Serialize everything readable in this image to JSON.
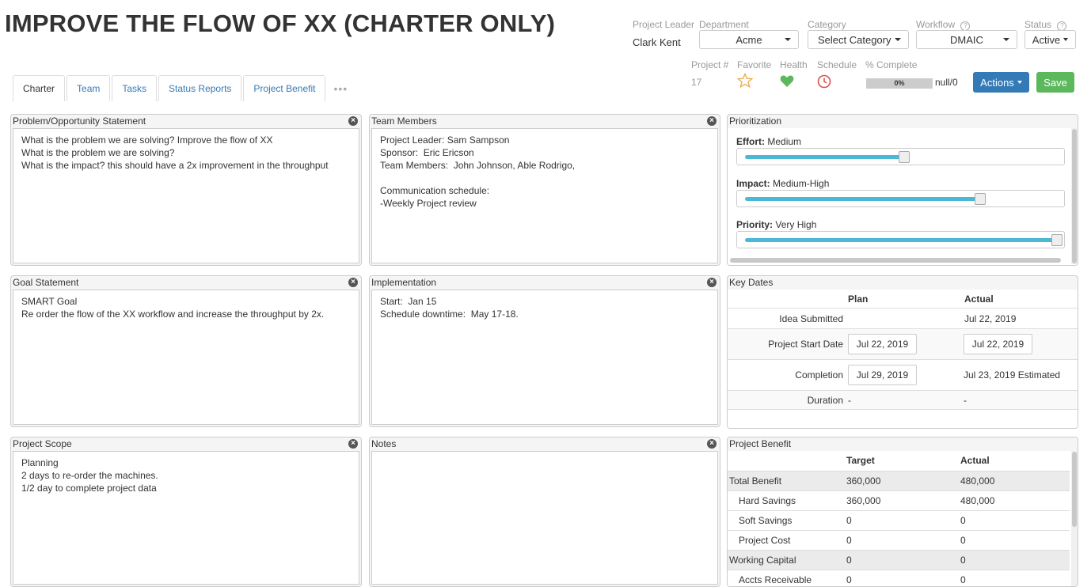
{
  "title": "IMPROVE THE FLOW OF XX (CHARTER ONLY)",
  "header": {
    "project_leader_label": "Project Leader",
    "project_leader": "Clark Kent",
    "department_label": "Department",
    "department": "Acme",
    "category_label": "Category",
    "category": "Select Category",
    "workflow_label": "Workflow",
    "workflow": "DMAIC",
    "status_label": "Status",
    "status": "Active",
    "project_no_label": "Project #",
    "project_no": "17",
    "favorite_label": "Favorite",
    "health_label": "Health",
    "schedule_label": "Schedule",
    "complete_label": "% Complete",
    "complete_pct": "0%",
    "complete_fraction": 0,
    "complete_ratio": "null/0",
    "actions_label": "Actions",
    "save_label": "Save"
  },
  "tabs": [
    "Charter",
    "Team",
    "Tasks",
    "Status Reports",
    "Project Benefit"
  ],
  "more": "•••",
  "panels": {
    "problem": {
      "title": "Problem/Opportunity Statement",
      "text": "What is the problem we are solving? Improve the flow of XX\nWhat is the problem we are solving?\nWhat is the impact? this should have a 2x improvement in the throughput"
    },
    "team": {
      "title": "Team Members",
      "text": "Project Leader: Sam Sampson\nSponsor:  Eric Ericson\nTeam Members:  John Johnson, Able Rodrigo,\n\nCommunication schedule:\n-Weekly Project review"
    },
    "goal": {
      "title": "Goal Statement",
      "text": "SMART Goal\nRe order the flow of the XX workflow and increase the throughput by 2x."
    },
    "implementation": {
      "title": "Implementation",
      "text": "Start:  Jan 15\nSchedule downtime:  May 17-18."
    },
    "scope": {
      "title": "Project Scope",
      "text": "Planning\n2 days to re-order the machines.\n1/2 day to complete project data"
    },
    "notes": {
      "title": "Notes",
      "text": ""
    }
  },
  "prioritization": {
    "title": "Prioritization",
    "items": [
      {
        "label": "Effort:",
        "value": "Medium",
        "level": 0.5
      },
      {
        "label": "Impact:",
        "value": "Medium-High",
        "level": 0.75
      },
      {
        "label": "Priority:",
        "value": "Very High",
        "level": 1.0
      }
    ]
  },
  "key_dates": {
    "title": "Key Dates",
    "col_plan": "Plan",
    "col_actual": "Actual",
    "rows": [
      {
        "label": "Idea Submitted",
        "plan": "",
        "actual": "Jul 22, 2019"
      },
      {
        "label": "Project Start Date",
        "plan": "Jul 22, 2019",
        "actual": "Jul 22, 2019"
      },
      {
        "label": "Completion",
        "plan": "Jul 29, 2019",
        "actual": "Jul 23, 2019 Estimated"
      },
      {
        "label": "Duration",
        "plan": "-",
        "actual": "-"
      }
    ]
  },
  "benefit": {
    "title": "Project Benefit",
    "col_target": "Target",
    "col_actual": "Actual",
    "rows": [
      {
        "label": "Total Benefit",
        "target": "360,000",
        "actual": "480,000"
      },
      {
        "label": "Hard Savings",
        "target": "360,000",
        "actual": "480,000"
      },
      {
        "label": "Soft Savings",
        "target": "0",
        "actual": "0"
      },
      {
        "label": "Project Cost",
        "target": "0",
        "actual": "0"
      },
      {
        "label": "Working Capital",
        "target": "0",
        "actual": "0"
      },
      {
        "label": "Accts Receivable",
        "target": "0",
        "actual": "0"
      }
    ]
  }
}
